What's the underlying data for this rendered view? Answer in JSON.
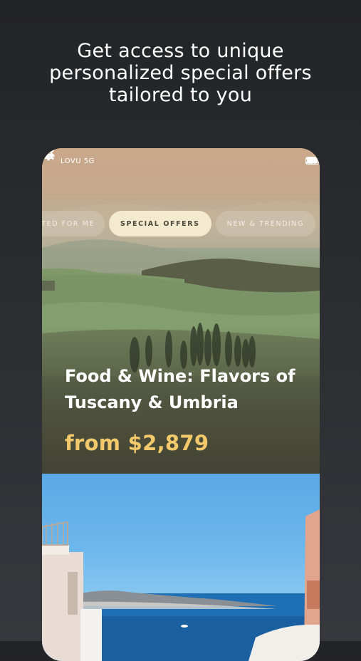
{
  "headline": {
    "line1": "Get access to unique",
    "line2": "personalized special offers",
    "line3": "tailored to you"
  },
  "status_bar": {
    "carrier": "LOVU 5G",
    "icons": [
      "signal-icon",
      "wifi-icon",
      "battery-icon"
    ]
  },
  "nav": {
    "icons": [
      "back-arrow-icon",
      "search-icon",
      "bell-icon",
      "menu-icon"
    ]
  },
  "tabs": [
    {
      "label": "TED FOR ME",
      "active": false
    },
    {
      "label": "SPECIAL OFFERS",
      "active": true
    },
    {
      "label": "NEW & TRENDING",
      "active": false
    },
    {
      "label": "",
      "active": false
    }
  ],
  "offer": {
    "title_line1": "Food & Wine: Flavors of",
    "title_line2": "Tuscany & Umbria",
    "price": "from $2,879"
  },
  "colors": {
    "price_accent": "#f2c96b",
    "active_tab_bg": "#f3ead0",
    "page_bg": "#2c2e32"
  }
}
